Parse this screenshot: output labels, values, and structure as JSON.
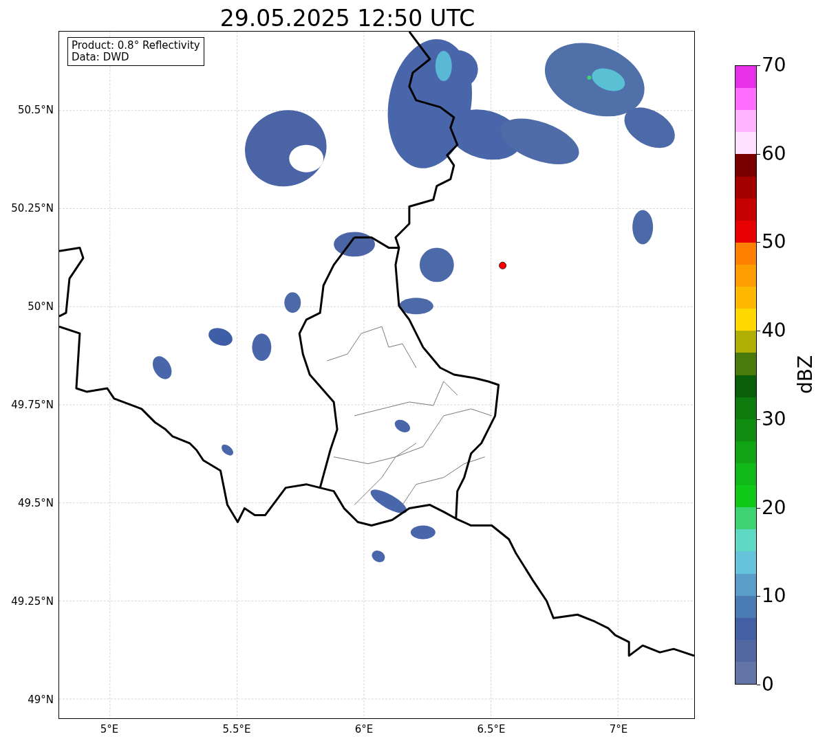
{
  "title": "29.05.2025 12:50 UTC",
  "map": {
    "legend": [
      "Product: 0.8° Reflectivity",
      "Data: DWD"
    ],
    "y_ticks": [
      "50.5°N",
      "50.25°N",
      "50°N",
      "49.75°N",
      "49.5°N",
      "49.25°N",
      "49°N"
    ],
    "x_ticks": [
      "5°E",
      "5.5°E",
      "6°E",
      "6.5°E",
      "7°E"
    ]
  },
  "colorbar": {
    "ticks": [
      "70",
      "60",
      "50",
      "40",
      "30",
      "20",
      "10",
      "0"
    ],
    "label": "dBZ",
    "bands": [
      {
        "color": "#e830e8"
      },
      {
        "color": "#ff6cff"
      },
      {
        "color": "#ffb4ff"
      },
      {
        "color": "#ffe0ff"
      },
      {
        "color": "#7a0000"
      },
      {
        "color": "#a40000"
      },
      {
        "color": "#c40000"
      },
      {
        "color": "#e60000"
      },
      {
        "color": "#ff8000"
      },
      {
        "color": "#ff9c00"
      },
      {
        "color": "#ffb800"
      },
      {
        "color": "#ffd800"
      },
      {
        "color": "#b0b004"
      },
      {
        "color": "#4a7a0a"
      },
      {
        "color": "#0a5e0a"
      },
      {
        "color": "#0c7a0c"
      },
      {
        "color": "#108c10"
      },
      {
        "color": "#10a414"
      },
      {
        "color": "#10b818"
      },
      {
        "color": "#10c818"
      },
      {
        "color": "#3ed474"
      },
      {
        "color": "#5fd8c4"
      },
      {
        "color": "#66c3dc"
      },
      {
        "color": "#5a9dc8"
      },
      {
        "color": "#4a7bb2"
      },
      {
        "color": "#4360a4"
      },
      {
        "color": "#5367a0"
      },
      {
        "color": "#6474a6"
      }
    ]
  }
}
